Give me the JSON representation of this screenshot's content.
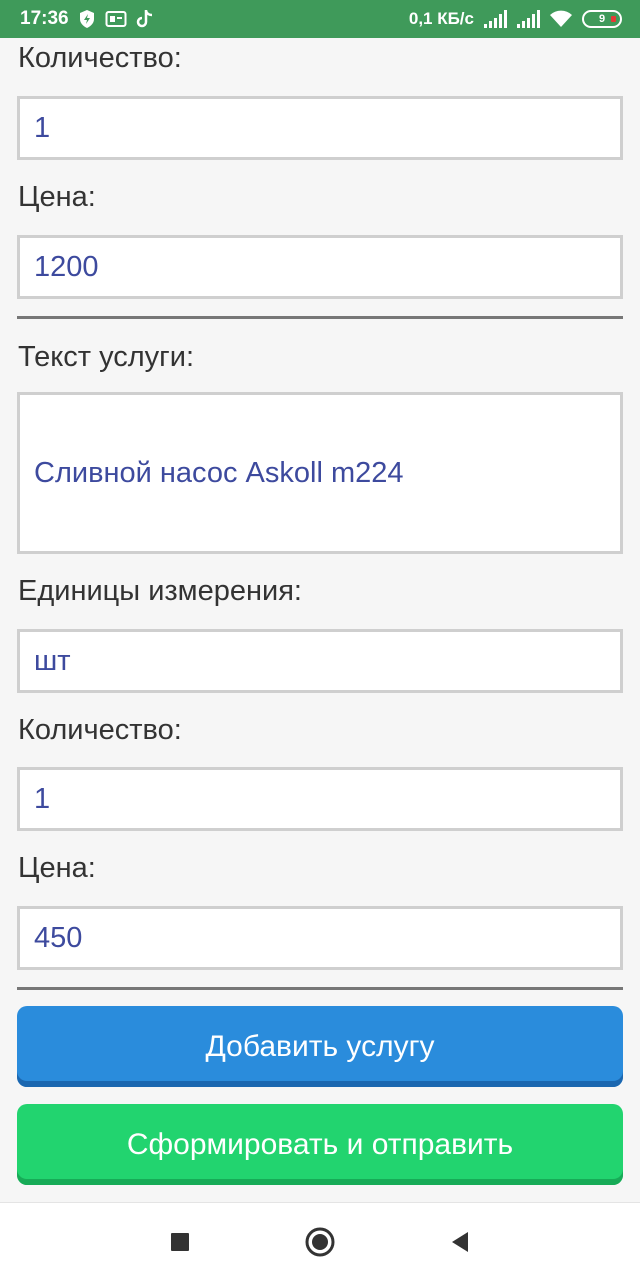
{
  "status_bar": {
    "time": "17:36",
    "net_speed": "0,1 КБ/с",
    "battery": "9",
    "colors": {
      "background": "#3f9a5a",
      "battery_low": "#e53935"
    },
    "icons": [
      "shield-icon",
      "card-icon",
      "tiktok-icon",
      "signal-icon",
      "signal-icon",
      "wifi-icon",
      "battery-icon"
    ]
  },
  "form": {
    "group1": {
      "quantity_label": "Количество:",
      "quantity_value": "1",
      "price_label": "Цена:",
      "price_value": "1200"
    },
    "group2": {
      "service_text_label": "Текст услуги:",
      "service_text_value": "Сливной насос Askoll m224",
      "units_label": "Единицы измерения:",
      "units_value": "шт",
      "quantity_label": "Количество:",
      "quantity_value": "1",
      "price_label": "Цена:",
      "price_value": "450"
    }
  },
  "buttons": {
    "add_service": "Добавить услугу",
    "submit": "Сформировать и отправить",
    "colors": {
      "add": "#2a8cdc",
      "submit": "#22d46f"
    }
  },
  "nav_bar": {
    "icons": [
      "recent-apps-icon",
      "home-icon",
      "back-icon"
    ]
  },
  "colors": {
    "input_text": "#3d4a9e",
    "label_text": "#333333",
    "input_border": "#cfcfcf"
  }
}
